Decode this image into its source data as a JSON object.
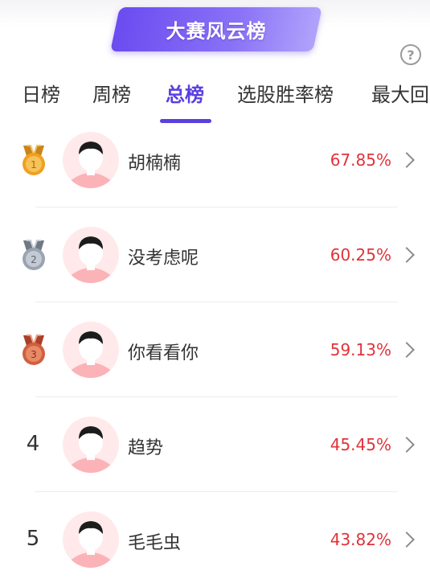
{
  "banner": {
    "title": "大赛风云榜"
  },
  "help": {
    "icon": "question-circle-icon",
    "glyph": "?"
  },
  "tabs": [
    {
      "label": "日榜",
      "active": false
    },
    {
      "label": "周榜",
      "active": false
    },
    {
      "label": "总榜",
      "active": true
    },
    {
      "label": "选股胜率榜",
      "active": false
    },
    {
      "label": "最大回",
      "active": false
    }
  ],
  "colors": {
    "accent": "#5b3fe0",
    "rate": "#e0333a",
    "gold": "#f0a020",
    "silver": "#9aa4b0",
    "bronze": "#d0603e"
  },
  "ranking": [
    {
      "rank": "1",
      "medal": "gold",
      "name": "胡楠楠",
      "rate": "67.85%"
    },
    {
      "rank": "2",
      "medal": "silver",
      "name": "没考虑呢",
      "rate": "60.25%"
    },
    {
      "rank": "3",
      "medal": "bronze",
      "name": "你看看你",
      "rate": "59.13%"
    },
    {
      "rank": "4",
      "medal": null,
      "name": "趋势",
      "rate": "45.45%"
    },
    {
      "rank": "5",
      "medal": null,
      "name": "毛毛虫",
      "rate": "43.82%"
    }
  ]
}
